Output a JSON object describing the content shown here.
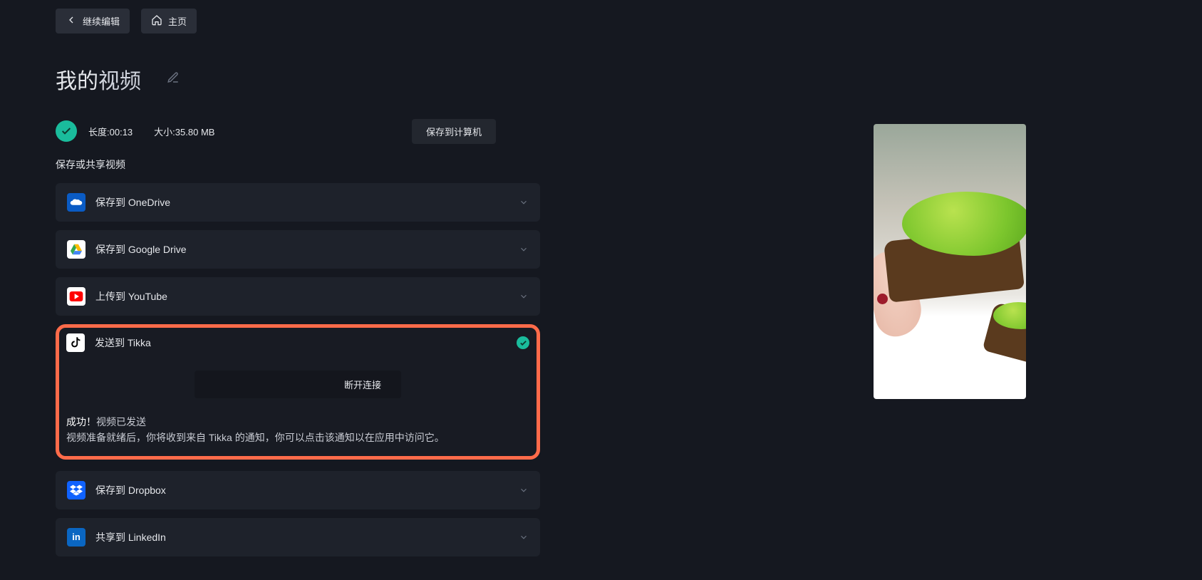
{
  "top": {
    "continue_edit": "继续编辑",
    "home": "主页"
  },
  "title": {
    "bold": "我的",
    "light": "视频"
  },
  "stats": {
    "length_label": "长度:",
    "length_value": "00:13",
    "size_label": "大小:",
    "size_value": "35.80 MB"
  },
  "save_computer": "保存到计算机",
  "share_label": "保存或共享视频",
  "rows": {
    "onedrive": "保存到 OneDrive",
    "gdrive": "保存到 Google Drive",
    "youtube": "上传到 YouTube",
    "tiktok": "发送到 Tikka",
    "dropbox": "保存到 Dropbox",
    "linkedin": "共享到 LinkedIn"
  },
  "tiktok_panel": {
    "disconnect": "断开连接",
    "success_line1_a": "成功！",
    "success_line1_b": "视频已发送",
    "success_line2": "视频准备就绪后，你将收到来自 Tikka 的通知，你可以点击该通知以在应用中访问它。"
  }
}
